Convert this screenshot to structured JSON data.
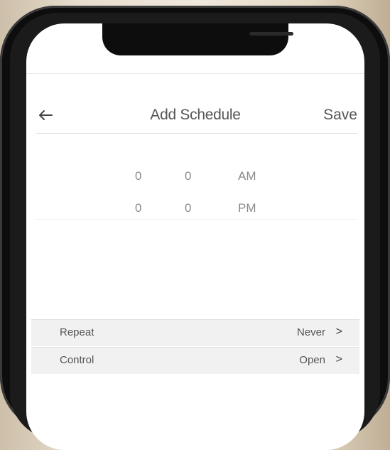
{
  "header": {
    "title": "Add Schedule",
    "save_label": "Save"
  },
  "time_picker": {
    "start": {
      "hour": "0",
      "minute": "0",
      "period": "AM"
    },
    "end": {
      "hour": "0",
      "minute": "0",
      "period": "PM"
    }
  },
  "settings": [
    {
      "label": "Repeat",
      "value": "Never"
    },
    {
      "label": "Control",
      "value": "Open"
    }
  ],
  "icons": {
    "back": "arrow-left-icon",
    "chevron": "chevron-right-icon"
  }
}
